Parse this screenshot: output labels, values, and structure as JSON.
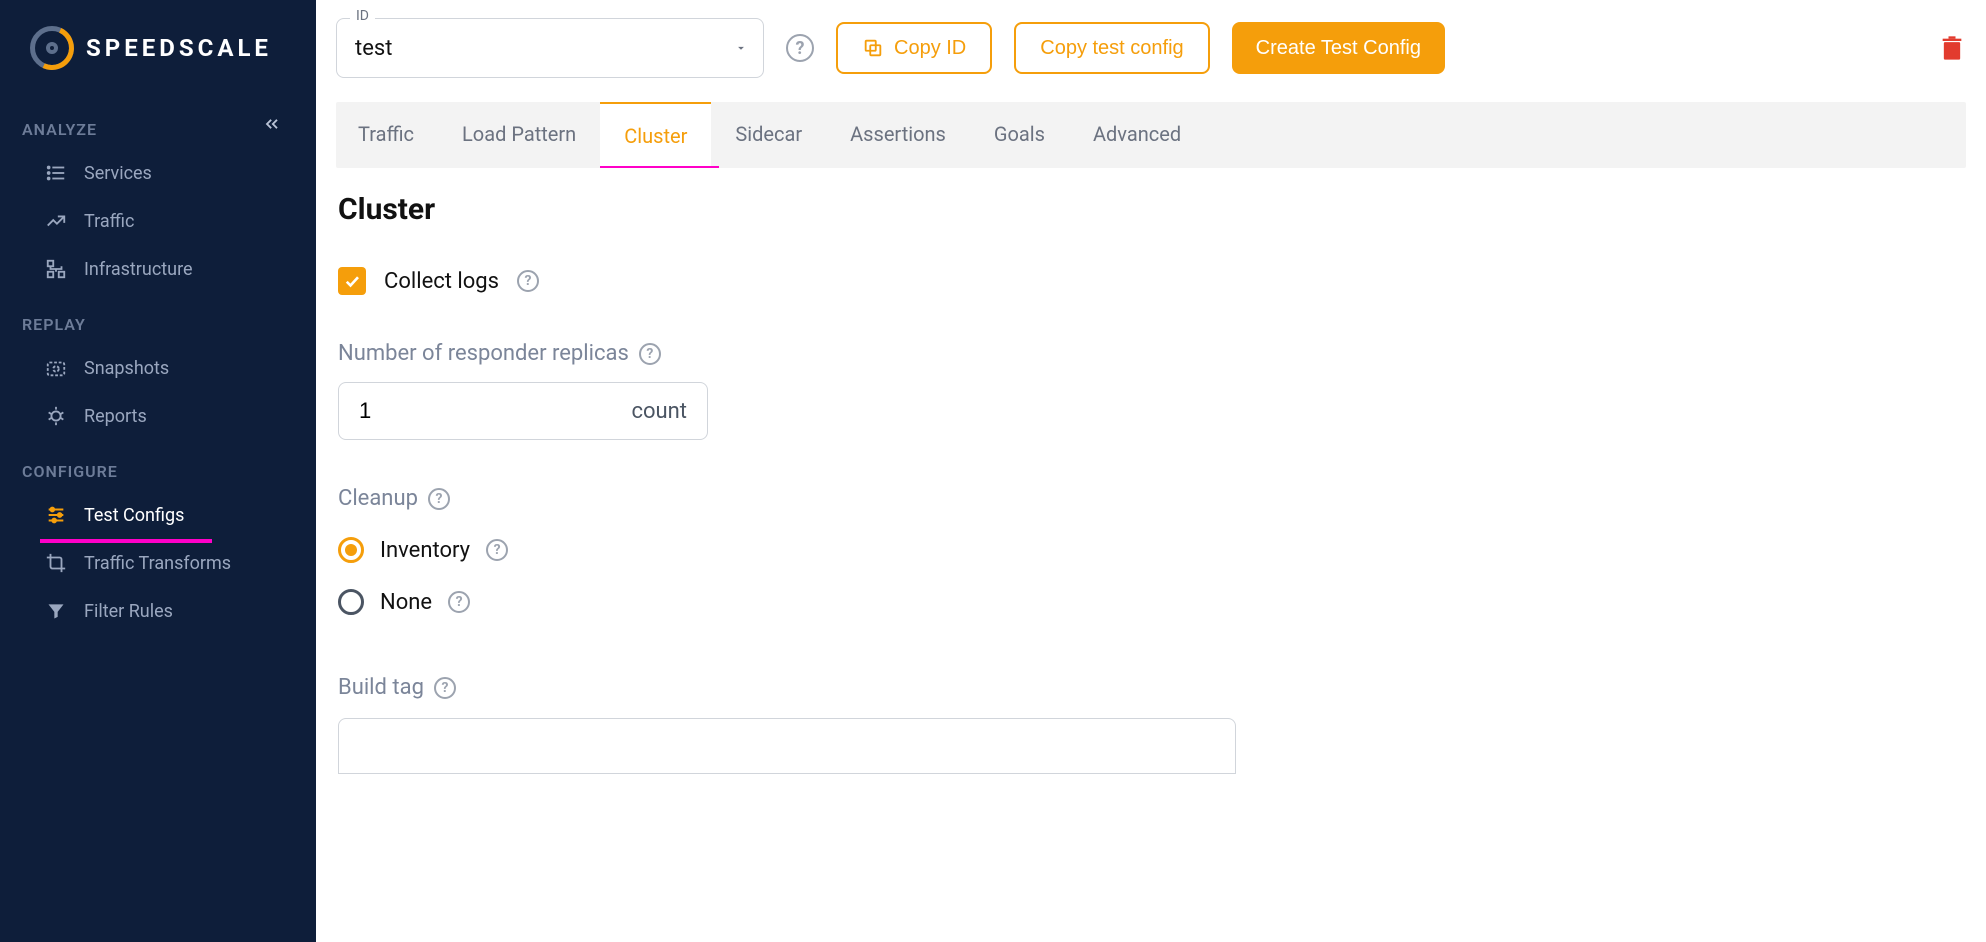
{
  "brand": {
    "name": "SPEEDSCALE"
  },
  "sidebar": {
    "sections": [
      {
        "title": "ANALYZE",
        "items": [
          {
            "label": "Services"
          },
          {
            "label": "Traffic"
          },
          {
            "label": "Infrastructure"
          }
        ]
      },
      {
        "title": "REPLAY",
        "items": [
          {
            "label": "Snapshots"
          },
          {
            "label": "Reports"
          }
        ]
      },
      {
        "title": "CONFIGURE",
        "items": [
          {
            "label": "Test Configs",
            "active": true
          },
          {
            "label": "Traffic Transforms"
          },
          {
            "label": "Filter Rules"
          }
        ]
      }
    ]
  },
  "header": {
    "id_label": "ID",
    "id_value": "test",
    "copy_id_label": "Copy ID",
    "copy_config_label": "Copy test config",
    "create_config_label": "Create Test Config"
  },
  "tabs": [
    {
      "label": "Traffic"
    },
    {
      "label": "Load Pattern"
    },
    {
      "label": "Cluster",
      "active": true
    },
    {
      "label": "Sidecar"
    },
    {
      "label": "Assertions"
    },
    {
      "label": "Goals"
    },
    {
      "label": "Advanced"
    }
  ],
  "cluster": {
    "title": "Cluster",
    "collect_logs_label": "Collect logs",
    "collect_logs_checked": true,
    "replicas_label": "Number of responder replicas",
    "replicas_value": "1",
    "replicas_unit": "count",
    "cleanup_label": "Cleanup",
    "cleanup_options": [
      {
        "label": "Inventory",
        "selected": true
      },
      {
        "label": "None",
        "selected": false
      }
    ],
    "build_tag_label": "Build tag",
    "build_tag_value": ""
  }
}
